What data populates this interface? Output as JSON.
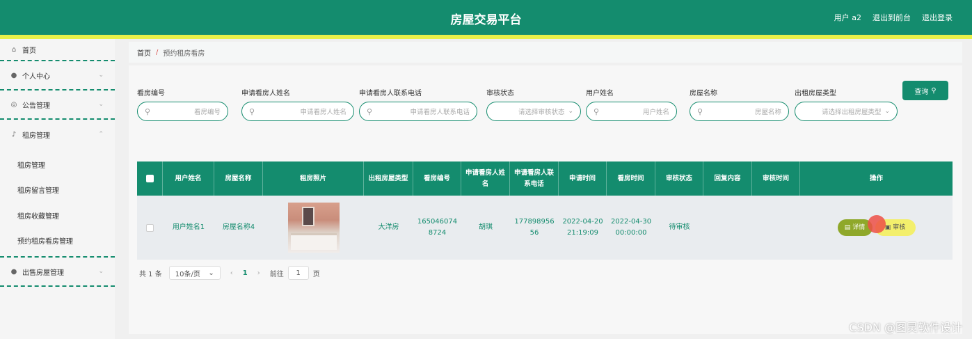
{
  "header": {
    "title": "房屋交易平台",
    "user": "用户 a2",
    "back_front": "退出到前台",
    "logout": "退出登录"
  },
  "sidebar": {
    "items": [
      {
        "label": "首页",
        "icon": "home-icon"
      },
      {
        "label": "个人中心",
        "icon": "user-icon",
        "chevron": "⌄"
      },
      {
        "label": "公告管理",
        "icon": "compass-icon",
        "chevron": "⌄"
      },
      {
        "label": "租房管理",
        "icon": "mic-icon",
        "chevron": "⌃"
      },
      {
        "label": "出售房屋管理",
        "icon": "bulb-icon",
        "chevron": "⌄"
      }
    ],
    "submenu": [
      "租房管理",
      "租房留言管理",
      "租房收藏管理",
      "预约租房看房管理"
    ]
  },
  "breadcrumb": {
    "home": "首页",
    "separator": "/",
    "current": "预约租房看房"
  },
  "search": {
    "fields": [
      {
        "label": "看房编号",
        "placeholder": "看房编号"
      },
      {
        "label": "申请看房人姓名",
        "placeholder": "申请看房人姓名"
      },
      {
        "label": "申请看房人联系电话",
        "placeholder": "申请看房人联系电话"
      },
      {
        "label": "审核状态",
        "placeholder": "请选择审核状态"
      },
      {
        "label": "用户姓名",
        "placeholder": "用户姓名"
      },
      {
        "label": "房屋名称",
        "placeholder": "房屋名称"
      },
      {
        "label": "出租房屋类型",
        "placeholder": "请选择出租房屋类型"
      }
    ],
    "query_button": "查询"
  },
  "table": {
    "headers": [
      "用户姓名",
      "房屋名称",
      "租房照片",
      "出租房屋类型",
      "看房编号",
      "申请看房人姓名",
      "申请看房人联系电话",
      "申请时间",
      "看房时间",
      "审核状态",
      "回复内容",
      "审核时间",
      "操作"
    ],
    "rows": [
      {
        "user_name": "用户姓名1",
        "house_name": "房屋名称4",
        "house_type": "大洋房",
        "viewing_no": "1650460748724",
        "applicant": "胡琪",
        "phone": "17789895656",
        "apply_time": "2022-04-20 21:19:09",
        "view_time": "2022-04-30 00:00:00",
        "status": "待审核",
        "reply": "",
        "audit_time": "",
        "detail_btn": "详情",
        "audit_btn": "审核"
      }
    ]
  },
  "pagination": {
    "total": "共 1 条",
    "page_size": "10条/页",
    "current_page": "1",
    "goto_label": "前往",
    "goto_value": "1",
    "goto_suffix": "页"
  },
  "watermark": "CSDN @图灵软件设计",
  "colors": {
    "primary": "#148c6e",
    "stripe": "#e8f04a",
    "detail": "#8fa82a",
    "audit": "#f3ef6c"
  }
}
